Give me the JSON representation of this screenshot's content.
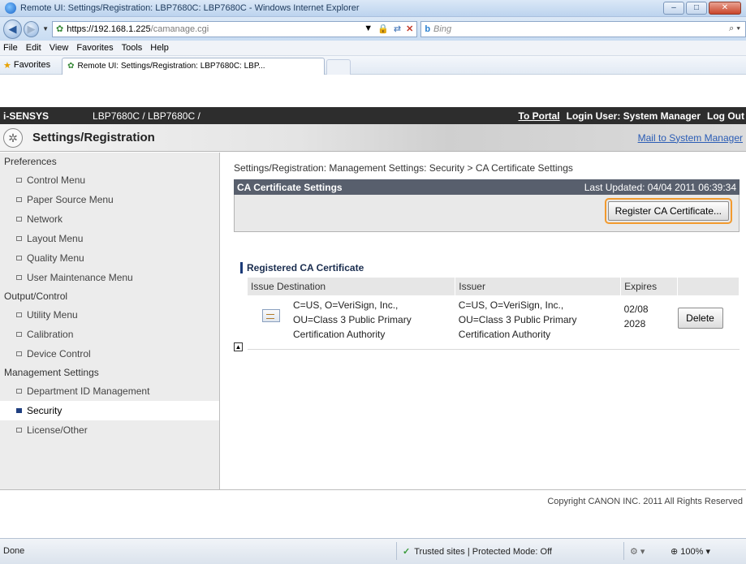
{
  "window": {
    "title": "Remote UI: Settings/Registration: LBP7680C: LBP7680C - Windows Internet Explorer",
    "controls": {
      "minimize": "–",
      "maximize": "□",
      "close": "✕"
    }
  },
  "addressbar": {
    "url_host": "https://192.168.1.225",
    "url_path": "/camanage.cgi",
    "search_placeholder": "Bing"
  },
  "menubar": {
    "items": [
      "File",
      "Edit",
      "View",
      "Favorites",
      "Tools",
      "Help"
    ]
  },
  "favorites": {
    "label": "Favorites",
    "tab_title": "Remote UI: Settings/Registration: LBP7680C: LBP..."
  },
  "brand": {
    "logo": "i-SENSYS",
    "model": "LBP7680C / LBP7680C /",
    "portal_link": "To Portal",
    "login_user": "Login User: System Manager",
    "logout": "Log Out"
  },
  "settings": {
    "title": "Settings/Registration",
    "mail_link": "Mail to System Manager"
  },
  "sidebar": {
    "groups": [
      {
        "heading": "Preferences",
        "items": [
          "Control Menu",
          "Paper Source Menu",
          "Network",
          "Layout Menu",
          "Quality Menu",
          "User Maintenance Menu"
        ]
      },
      {
        "heading": "Output/Control",
        "items": [
          "Utility Menu",
          "Calibration",
          "Device Control"
        ]
      },
      {
        "heading": "Management Settings",
        "items": [
          "Department ID Management",
          "Security",
          "License/Other"
        ]
      }
    ]
  },
  "main": {
    "breadcrumb": "Settings/Registration: Management Settings: Security > CA Certificate Settings",
    "panel_title": "CA Certificate Settings",
    "last_updated": "Last Updated: 04/04 2011 06:39:34",
    "register_button": "Register CA Certificate...",
    "registered_title": "Registered CA Certificate",
    "table": {
      "headers": [
        "Issue Destination",
        "Issuer",
        "Expires"
      ],
      "rows": [
        {
          "destination": [
            "C=US, O=VeriSign, Inc.,",
            "OU=Class 3 Public Primary",
            "Certification Authority"
          ],
          "issuer": [
            "C=US, O=VeriSign, Inc.,",
            "OU=Class 3 Public Primary",
            "Certification Authority"
          ],
          "expires": [
            "02/08",
            "2028"
          ],
          "delete_label": "Delete"
        }
      ]
    }
  },
  "footer": {
    "copyright": "Copyright CANON INC. 2011 All Rights Reserved"
  },
  "status": {
    "left": "Done",
    "zone": "Trusted sites | Protected Mode: Off",
    "zoom": "100%"
  }
}
